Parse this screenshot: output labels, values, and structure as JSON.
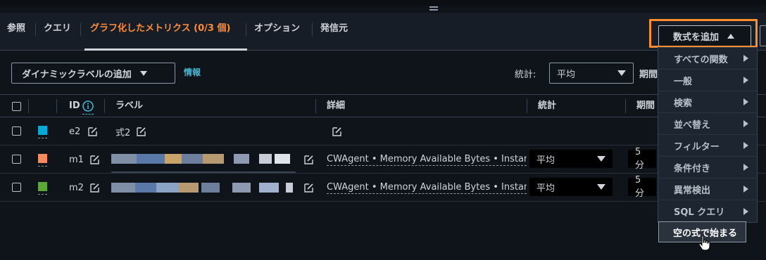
{
  "tabs": [
    {
      "label": "参照"
    },
    {
      "label": "クエリ"
    },
    {
      "label": "グラフ化したメトリクス (0/3 個)"
    },
    {
      "label": "オプション"
    },
    {
      "label": "発信元"
    }
  ],
  "toolbar": {
    "add_dynamic_label": "ダイナミックラベルの追加",
    "info_link": "情報",
    "stat_label": "統計:",
    "stat_value": "平均",
    "period_label": "期間",
    "add_math": "数式を追加"
  },
  "table": {
    "headers": {
      "id": "ID",
      "label": "ラベル",
      "details": "詳細",
      "stat": "統計",
      "period": "期間"
    },
    "rows": [
      {
        "id": "e2",
        "label": "式2",
        "color": "#0aa8d6",
        "details": "",
        "stat": "",
        "period": ""
      },
      {
        "id": "m1",
        "label": "",
        "color": "#f58a5e",
        "details": "CWAgent • Memory Available Bytes • Instance",
        "stat": "平均",
        "period": "5 分"
      },
      {
        "id": "m2",
        "label": "",
        "color": "#5ea83a",
        "details": "CWAgent • Memory Available Bytes • Instance",
        "stat": "平均",
        "period": "5 分"
      }
    ]
  },
  "menu": {
    "items": [
      {
        "label": "すべての関数"
      },
      {
        "label": "一般"
      },
      {
        "label": "検索"
      },
      {
        "label": "並べ替え"
      },
      {
        "label": "フィルター"
      },
      {
        "label": "条件付き"
      },
      {
        "label": "異常検出"
      },
      {
        "label": "SQL クエリ"
      }
    ],
    "start_empty": "空の式で始まる"
  },
  "colors": {
    "accent": "#ff8c3a",
    "link": "#44b9d6",
    "highlight": "#ff8c2e"
  }
}
